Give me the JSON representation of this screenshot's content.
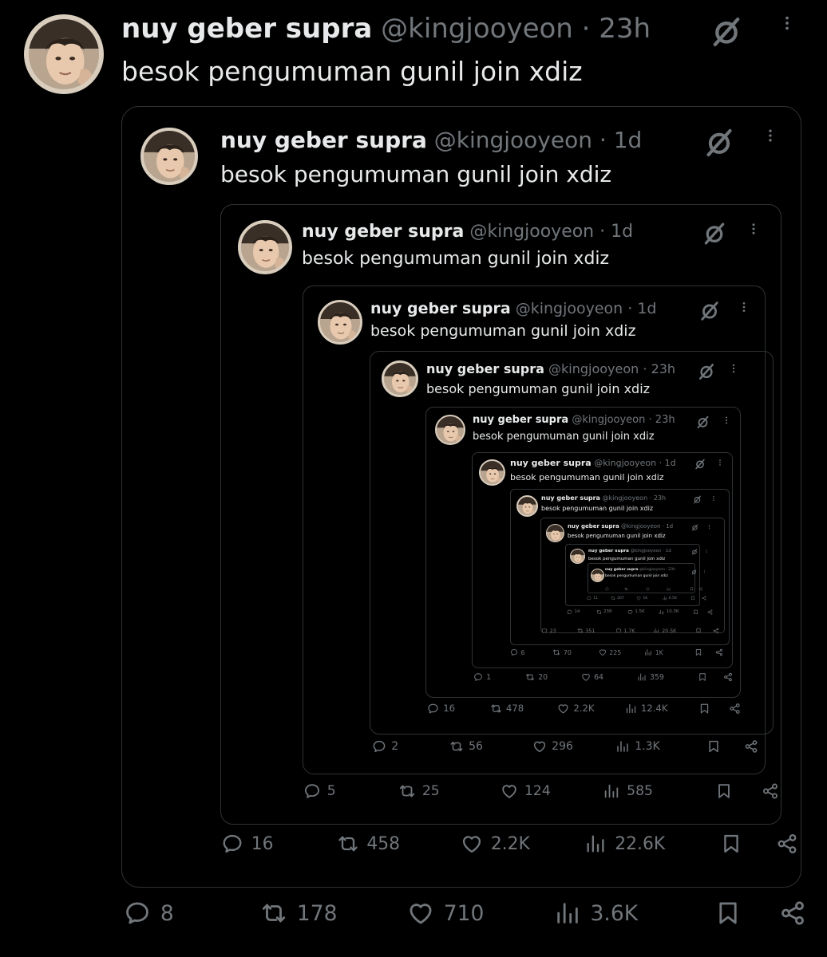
{
  "tweets": [
    {
      "name": "nuy geber supra",
      "handle": "@kingjooyeon",
      "dot": "·",
      "time": "23h",
      "text": "besok pengumuman gunil join xdiz",
      "stats": {
        "replies": "8",
        "reposts": "178",
        "likes": "710",
        "views": "3.6K"
      }
    },
    {
      "name": "nuy geber supra",
      "handle": "@kingjooyeon",
      "dot": "·",
      "time": "1d",
      "text": "besok pengumuman gunil join xdiz",
      "stats": {
        "replies": "16",
        "reposts": "458",
        "likes": "2.2K",
        "views": "22.6K"
      }
    },
    {
      "name": "nuy geber supra",
      "handle": "@kingjooyeon",
      "dot": "·",
      "time": "1d",
      "text": "besok pengumuman gunil join xdiz",
      "stats": {
        "replies": "5",
        "reposts": "25",
        "likes": "124",
        "views": "585"
      }
    },
    {
      "name": "nuy geber supra",
      "handle": "@kingjooyeon",
      "dot": "·",
      "time": "1d",
      "text": "besok pengumuman gunil join xdiz",
      "stats": {
        "replies": "2",
        "reposts": "56",
        "likes": "296",
        "views": "1.3K"
      }
    },
    {
      "name": "nuy geber supra",
      "handle": "@kingjooyeon",
      "dot": "·",
      "time": "23h",
      "text": "besok pengumuman gunil join xdiz",
      "stats": {
        "replies": "16",
        "reposts": "478",
        "likes": "2.2K",
        "views": "12.4K"
      }
    },
    {
      "name": "nuy geber supra",
      "handle": "@kingjooyeon",
      "dot": "·",
      "time": "23h",
      "text": "besok pengumuman gunil join xdiz",
      "stats": {
        "replies": "1",
        "reposts": "20",
        "likes": "64",
        "views": "359"
      }
    },
    {
      "name": "nuy geber supra",
      "handle": "@kingjooyeon",
      "dot": "·",
      "time": "1d",
      "text": "besok pengumuman gunil join xdiz",
      "stats": {
        "replies": "6",
        "reposts": "70",
        "likes": "225",
        "views": "1K"
      }
    },
    {
      "name": "nuy geber supra",
      "handle": "@kingjooyeon",
      "dot": "·",
      "time": "23h",
      "text": "besok pengumuman gunil join xdiz",
      "stats": {
        "replies": "23",
        "reposts": "351",
        "likes": "1.7K",
        "views": "20.5K"
      }
    },
    {
      "name": "nuy geber supra",
      "handle": "@kingjooyeon",
      "dot": "·",
      "time": "1d",
      "text": "besok pengumuman gunil join xdiz",
      "stats": {
        "replies": "14",
        "reposts": "238",
        "likes": "1.5K",
        "views": "10.3K"
      }
    },
    {
      "name": "nuy geber supra",
      "handle": "@kingjooyeon",
      "dot": "·",
      "time": "1d",
      "text": "besok pengumuman gunil join xdiz",
      "stats": {
        "replies": "11",
        "reposts": "207",
        "likes": "1K",
        "views": "6.5K"
      }
    },
    {
      "name": "nuy geber supra",
      "handle": "@kingjooyeon",
      "dot": "·",
      "time": "23h",
      "text": "besok pengumuman gunil join xdiz",
      "stats": {
        "replies": "",
        "reposts": "",
        "likes": "",
        "views": ""
      }
    }
  ],
  "icons": {
    "avatar": "avatar-photo",
    "grok": "grok-icon",
    "more": "more-options-icon",
    "reply": "reply-icon",
    "repost": "repost-icon",
    "like": "like-icon",
    "views": "views-icon",
    "bookmark": "bookmark-icon",
    "share": "share-icon"
  },
  "colors": {
    "background": "#000000",
    "text": "#e7e9ea",
    "muted": "#71767b",
    "border": "#2f3336"
  }
}
